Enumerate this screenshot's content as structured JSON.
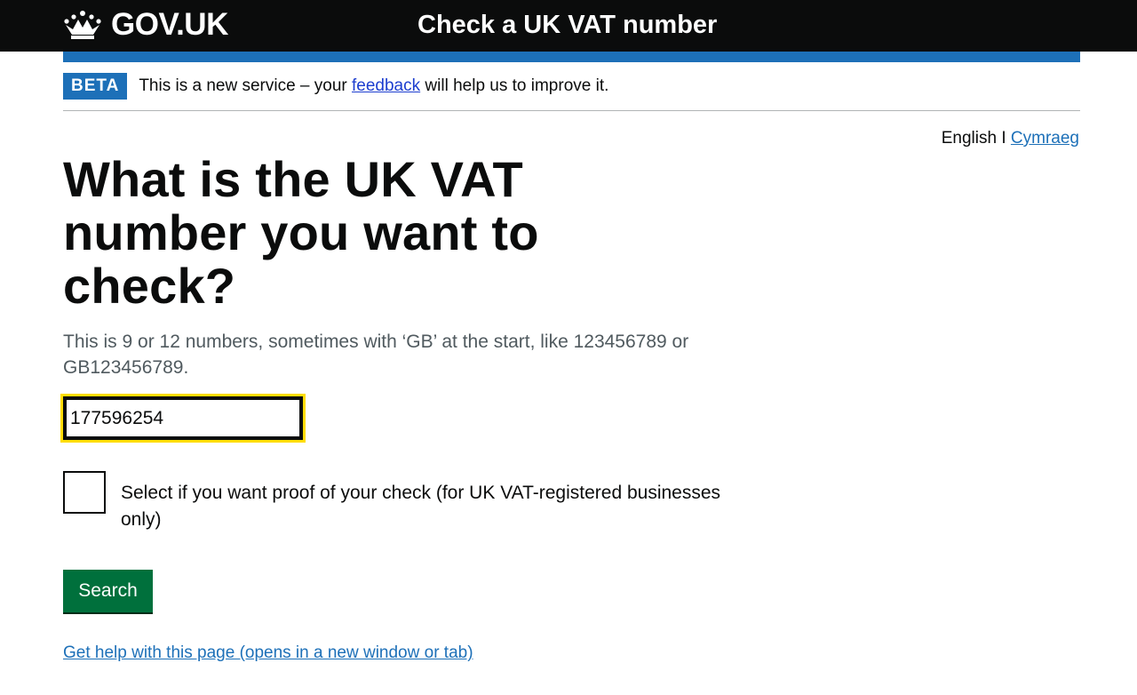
{
  "header": {
    "logo_text": "GOV.UK",
    "service_name": "Check a UK VAT number"
  },
  "phase_banner": {
    "tag": "BETA",
    "text_before": "This is a new service – your ",
    "link": "feedback",
    "text_after": " will help us to improve it."
  },
  "language": {
    "current": "English",
    "separator": " I ",
    "alternate": "Cymraeg"
  },
  "form": {
    "heading": "What is the UK VAT number you want to check?",
    "hint": "This is 9 or 12 numbers, sometimes with ‘GB’ at the start, like 123456789 or GB123456789.",
    "vat_value": "177596254",
    "checkbox_label": "Select if you want proof of your check (for UK VAT-registered businesses only)",
    "submit_label": "Search"
  },
  "help_link": "Get help with this page (opens in a new window or tab)",
  "colors": {
    "header": "#0b0c0c",
    "brand_blue": "#1d70b8",
    "button_green": "#00703c",
    "focus_yellow": "#ffdd00"
  }
}
